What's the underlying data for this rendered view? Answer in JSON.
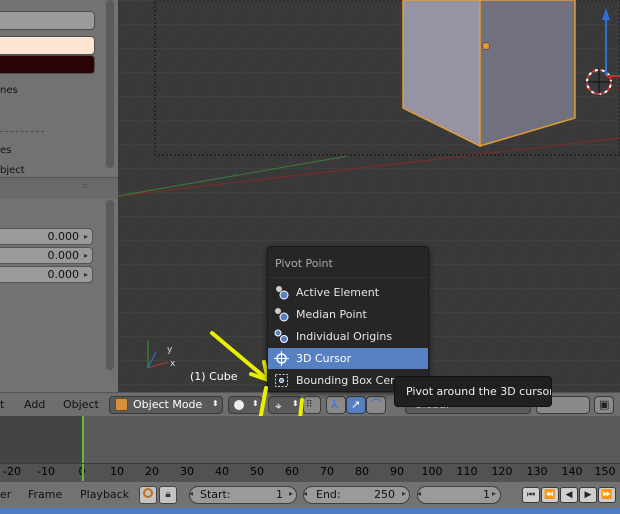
{
  "left_panel": {
    "items": [
      {
        "label": "nes"
      },
      {
        "label": "es"
      },
      {
        "label": "bject"
      }
    ],
    "fields": [
      {
        "value": "0.000"
      },
      {
        "value": "0.000"
      },
      {
        "value": "0.000"
      }
    ]
  },
  "viewport": {
    "object_label": "(1) Cube",
    "axes": {
      "x": "x",
      "y": "y"
    }
  },
  "header": {
    "menu_view_partial": "t",
    "menu_add": "Add",
    "menu_object": "Object",
    "mode": "Object Mode",
    "orientation": "Global"
  },
  "pivot_menu": {
    "title": "Pivot Point",
    "items": [
      {
        "label": "Active Element"
      },
      {
        "label": "Median Point"
      },
      {
        "label": "Individual Origins"
      },
      {
        "label": "3D Cursor",
        "selected": true
      },
      {
        "label": "Bounding Box Center"
      }
    ],
    "tooltip": "Pivot around the 3D cursor"
  },
  "timeline": {
    "ticks": [
      "-20",
      "-10",
      "0",
      "10",
      "20",
      "30",
      "40",
      "50",
      "60",
      "70",
      "80",
      "90",
      "100",
      "110",
      "120",
      "130",
      "140",
      "150"
    ],
    "current_frame_marker": "0"
  },
  "bottom_bar": {
    "menu_marker_partial": "er",
    "menu_frame": "Frame",
    "menu_playback": "Playback",
    "start_label": "Start:",
    "start_value": "1",
    "end_label": "End:",
    "end_value": "250",
    "current_frame": "1"
  },
  "colors": {
    "accent": "#5680c2",
    "annotation": "#e8f000",
    "active_menu": "#5680c2"
  }
}
